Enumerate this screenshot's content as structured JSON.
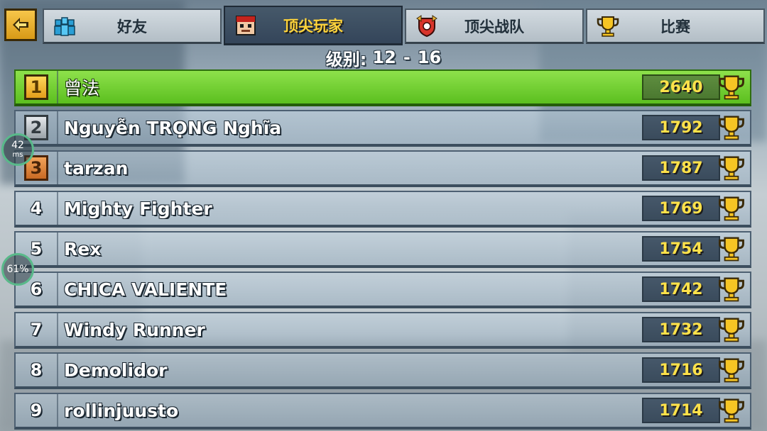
{
  "tabs": [
    {
      "id": "friends",
      "label": "好友",
      "icon": "friends-icon",
      "active": false
    },
    {
      "id": "top-players",
      "label": "顶尖玩家",
      "icon": "player-face-icon",
      "active": true
    },
    {
      "id": "top-clans",
      "label": "顶尖战队",
      "icon": "clan-shield-icon",
      "active": false
    },
    {
      "id": "tournaments",
      "label": "比赛",
      "icon": "trophy-icon",
      "active": false
    }
  ],
  "back_button": {
    "icon": "back-arrow-icon"
  },
  "level": {
    "label": "级别:",
    "min": "12",
    "sep": "-",
    "max": "16"
  },
  "leaderboard": [
    {
      "rank": "1",
      "name": "曾法",
      "score": "2640",
      "medal": "gold"
    },
    {
      "rank": "2",
      "name": "Nguyễn TRỌNG Nghĩa",
      "score": "1792",
      "medal": "silver"
    },
    {
      "rank": "3",
      "name": "tarzan",
      "score": "1787",
      "medal": "bronze"
    },
    {
      "rank": "4",
      "name": "Mighty Fighter",
      "score": "1769",
      "medal": ""
    },
    {
      "rank": "5",
      "name": "Rex",
      "score": "1754",
      "medal": ""
    },
    {
      "rank": "6",
      "name": "CHICA VALIENTE",
      "score": "1742",
      "medal": ""
    },
    {
      "rank": "7",
      "name": "Windy Runner",
      "score": "1732",
      "medal": ""
    },
    {
      "rank": "8",
      "name": "Demolidor",
      "score": "1716",
      "medal": ""
    },
    {
      "rank": "9",
      "name": "rollinjuusto",
      "score": "1714",
      "medal": ""
    }
  ],
  "overlay": {
    "ping_value": "42",
    "ping_unit": "ms",
    "battery": "61%"
  },
  "colors": {
    "first_row": "#6fcf2f",
    "score_text": "#ffe24a",
    "active_tab_text": "#ffd43a"
  }
}
